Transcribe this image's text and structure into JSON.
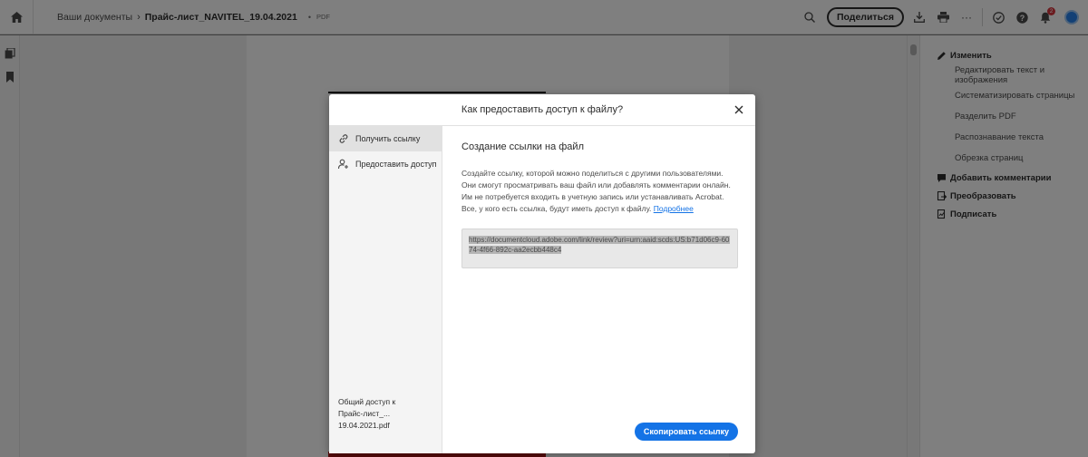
{
  "topbar": {
    "breadcrumb_root": "Ваши документы",
    "file_name": "Прайс-лист_NAVITEL_19.04.2021",
    "file_type": "PDF",
    "share_label": "Поделиться",
    "more_label": "···",
    "notification_count": "2"
  },
  "right_panel": {
    "edit": {
      "label": "Изменить",
      "items": [
        "Редактировать текст и изображения",
        "Систематизировать страницы",
        "Разделить PDF",
        "Распознавание текста",
        "Обрезка страниц"
      ]
    },
    "comment_label": "Добавить комментарии",
    "convert_label": "Преобразовать",
    "sign_label": "Подписать"
  },
  "modal": {
    "title": "Как предоставить доступ к файлу?",
    "side": {
      "get_link": "Получить ссылку",
      "share_access": "Предоставить доступ",
      "footer_line1": "Общий доступ к",
      "footer_line2": "Прайс-лист_... 19.04.2021.pdf"
    },
    "main": {
      "heading": "Создание ссылки на файл",
      "description": "Создайте ссылку, которой можно поделиться с другими пользователями. Они смогут просматривать ваш файл или добавлять комментарии онлайн. Им не потребуется входить в учетную запись или устанавливать Acrobat. Все, у кого есть ссылка, будут иметь доступ к файлу. ",
      "learn_more": "Подробнее",
      "link_url": "https://documentcloud.adobe.com/link/review?uri=urn:aaid:scds:US:b71d06c9-6074-4f66-892c-aa2ecbb448c4",
      "copy_button": "Скопировать ссылку"
    }
  },
  "colors": {
    "accent": "#1473e6",
    "badge": "#d7373f",
    "avatar": "#2680eb"
  }
}
